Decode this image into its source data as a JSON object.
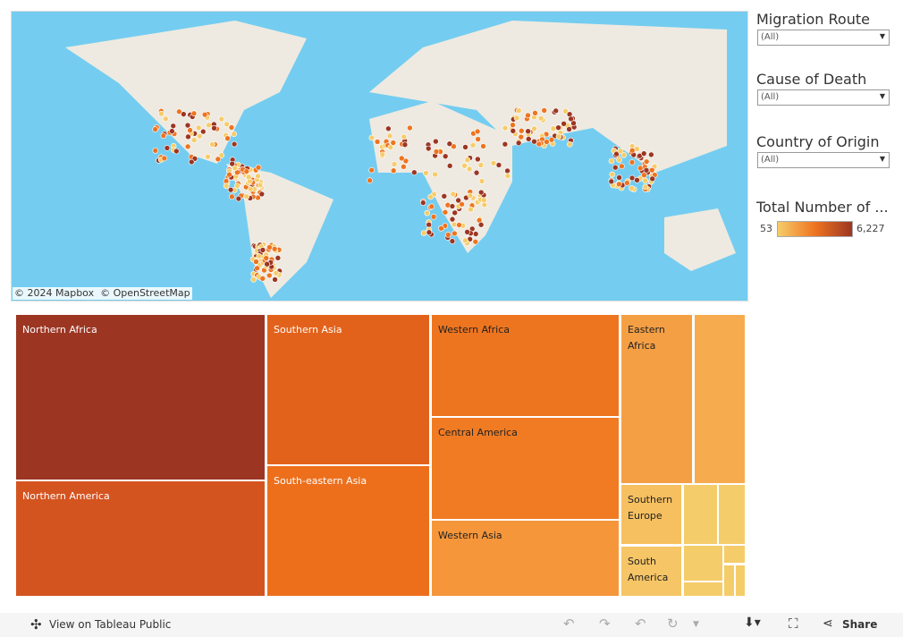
{
  "map": {
    "attribution": "© 2024 Mapbox  © OpenStreetMap",
    "water_color": "#74cdf0",
    "land_color": "#eeeae1"
  },
  "filters": [
    {
      "title": "Migration Route",
      "value": "(All)"
    },
    {
      "title": "Cause of Death",
      "value": "(All)"
    },
    {
      "title": "Country of Origin",
      "value": "(All)"
    }
  ],
  "legend": {
    "title": "Total Number of ...",
    "min": "53",
    "max": "6,227",
    "colors": [
      "#f6cc6a",
      "#ee7420",
      "#9c3623"
    ]
  },
  "treemap": [
    {
      "label": "Northern Africa",
      "color": "#9c3623"
    },
    {
      "label": "Northern America",
      "color": "#d45420"
    },
    {
      "label": "Southern Asia",
      "color": "#e3621b"
    },
    {
      "label": "South-eastern Asia",
      "color": "#ed6f1c"
    },
    {
      "label": "Western Africa",
      "color": "#ee751f"
    },
    {
      "label": "Central America",
      "color": "#f07b22"
    },
    {
      "label": "Western Asia",
      "color": "#f5963a"
    },
    {
      "label": "Eastern Africa",
      "color": "#f59f45"
    },
    {
      "label": "",
      "color": "#f7ab4f"
    },
    {
      "label": "Southern Europe",
      "color": "#f6c060"
    },
    {
      "label": "South America",
      "color": "#f6c566"
    }
  ],
  "toolbar": {
    "view_label": "View on Tableau Public",
    "share_label": "Share"
  }
}
